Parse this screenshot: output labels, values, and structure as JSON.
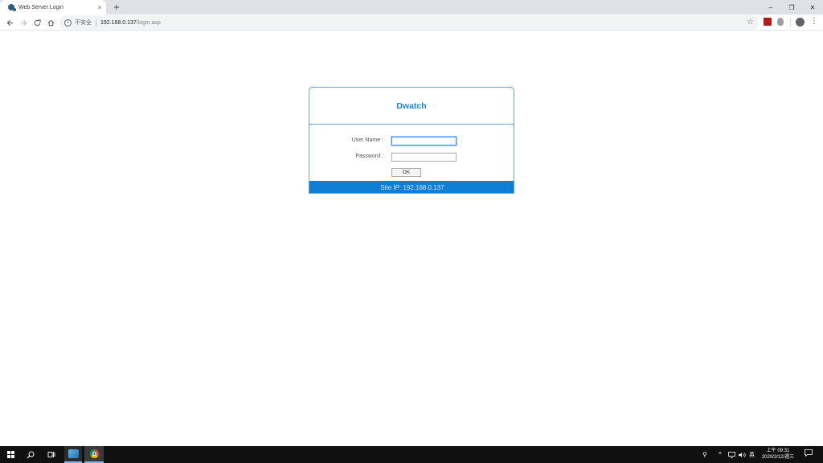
{
  "browser": {
    "tab_title": "Web Server Login",
    "tab_close": "×",
    "new_tab": "+",
    "win_minimize": "–",
    "win_restore": "❐",
    "win_close": "✕",
    "security_label": "不安全",
    "url_host": "192.168.0.137",
    "url_path": "/login.asp"
  },
  "login": {
    "brand": "Dwatch",
    "username_label": "User Name :",
    "password_label": "Password :",
    "username_value": "",
    "password_value": "",
    "ok_label": "OK",
    "site_ip": "Site IP: 192.168.0.137"
  },
  "taskbar": {
    "ime": "英",
    "time": "上午 09:31",
    "date": "2020/2/12/週三"
  },
  "icons": {
    "back": "arrow-left-icon",
    "forward": "arrow-right-icon",
    "reload": "reload-icon",
    "home": "home-icon",
    "star": "star-icon",
    "menu": "kebab-menu-icon"
  },
  "colors": {
    "brand": "#1a86d0",
    "site_bar": "#0f7fd6",
    "box_border": "#6fa0c8"
  }
}
